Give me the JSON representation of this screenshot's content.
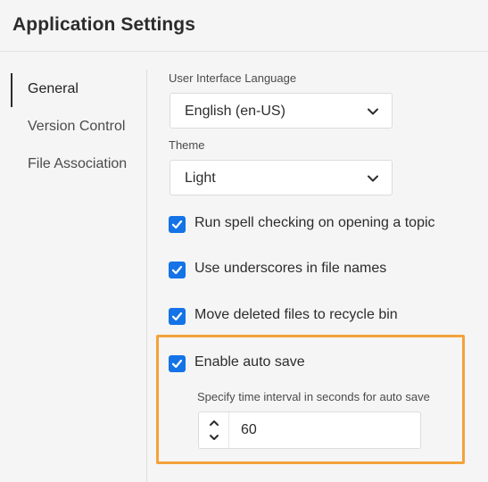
{
  "window": {
    "title": "Application Settings"
  },
  "sidebar": {
    "items": [
      {
        "label": "General",
        "active": true
      },
      {
        "label": "Version Control",
        "active": false
      },
      {
        "label": "File Association",
        "active": false
      }
    ]
  },
  "general": {
    "language": {
      "label": "User Interface Language",
      "value": "English (en-US)",
      "icon": "chevron-down-icon"
    },
    "theme": {
      "label": "Theme",
      "value": "Light",
      "icon": "chevron-down-icon"
    },
    "options": [
      {
        "label": "Run spell checking on opening a topic",
        "checked": true
      },
      {
        "label": "Use underscores in file names",
        "checked": true
      },
      {
        "label": "Move deleted files to recycle bin",
        "checked": true
      },
      {
        "label": "Enable auto save",
        "checked": true
      }
    ],
    "auto_save": {
      "interval_label": "Specify time interval in seconds for auto save",
      "interval_value": "60",
      "icons": [
        "chevron-up-icon",
        "chevron-down-icon"
      ]
    }
  },
  "colors": {
    "accent": "#1473e6",
    "highlight": "#f4a23a",
    "background": "#f5f5f5"
  }
}
